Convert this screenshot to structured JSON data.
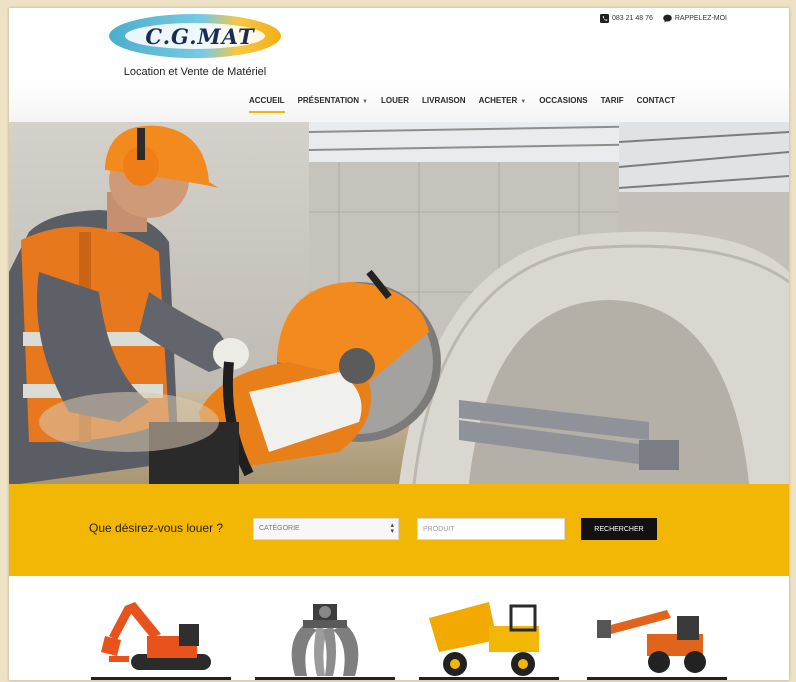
{
  "brand": {
    "name": "C.G.MAT",
    "tagline": "Location et Vente de Matériel"
  },
  "topbar": {
    "phone": "083 21 48 76",
    "callback": "RAPPELEZ-MOI"
  },
  "nav": {
    "items": [
      {
        "label": "ACCUEIL",
        "active": true,
        "dropdown": false
      },
      {
        "label": "PRÉSENTATION",
        "active": false,
        "dropdown": true
      },
      {
        "label": "LOUER",
        "active": false,
        "dropdown": false
      },
      {
        "label": "LIVRAISON",
        "active": false,
        "dropdown": false
      },
      {
        "label": "ACHETER",
        "active": false,
        "dropdown": true
      },
      {
        "label": "OCCASIONS",
        "active": false,
        "dropdown": false
      },
      {
        "label": "TARIF",
        "active": false,
        "dropdown": false
      },
      {
        "label": "CONTACT",
        "active": false,
        "dropdown": false
      }
    ]
  },
  "search": {
    "prompt": "Que désirez-vous louer ?",
    "category_value": "CATÉGORIE",
    "product_placeholder": "PRODUIT",
    "button_label": "RECHERCHER"
  },
  "products": [
    {
      "name": "excavator-icon"
    },
    {
      "name": "grapple-icon"
    },
    {
      "name": "dumper-icon"
    },
    {
      "name": "telehandler-icon"
    }
  ],
  "colors": {
    "accent": "#f2b705",
    "nav_text": "#2a2a2a",
    "button_bg": "#111111"
  }
}
